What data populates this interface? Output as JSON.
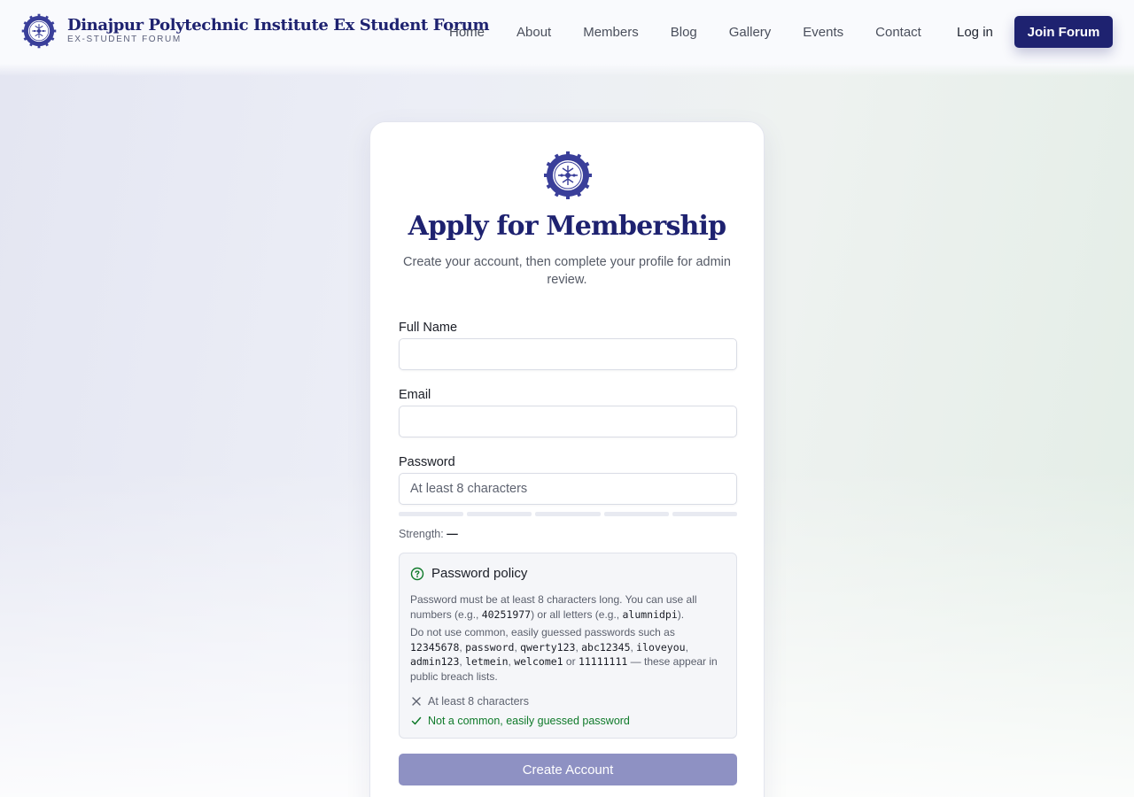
{
  "header": {
    "brand_title": "Dinajpur Polytechnic Institute Ex Student Forum",
    "brand_subtitle": "EX-STUDENT FORUM",
    "logo_icon": "institute-emblem-icon",
    "nav": [
      {
        "label": "Home"
      },
      {
        "label": "About"
      },
      {
        "label": "Members"
      },
      {
        "label": "Blog"
      },
      {
        "label": "Gallery"
      },
      {
        "label": "Events"
      },
      {
        "label": "Contact"
      }
    ],
    "login_label": "Log in",
    "join_label": "Join Forum"
  },
  "form": {
    "title": "Apply for Membership",
    "subtitle": "Create your account, then complete your profile for admin review.",
    "full_name": {
      "label": "Full Name",
      "value": "",
      "placeholder": ""
    },
    "email": {
      "label": "Email",
      "value": "",
      "placeholder": ""
    },
    "password": {
      "label": "Password",
      "value": "",
      "placeholder": "At least 8 characters"
    },
    "strength_label": "Strength:",
    "strength_value": "—",
    "strength_level": 0,
    "policy": {
      "title": "Password policy",
      "para1_a": "Password must be at least 8 characters long. You can use all numbers (e.g., ",
      "para1_code1": "40251977",
      "para1_b": ") or all letters (e.g., ",
      "para1_code2": "alumnidpi",
      "para1_c": ").",
      "para2_a": "Do not use common, easily guessed passwords such as ",
      "common": [
        "12345678",
        "password",
        "qwerty123",
        "abc12345",
        "iloveyou",
        "admin123",
        "letmein",
        "welcome1",
        "11111111"
      ],
      "para2_or": " or ",
      "para2_b": " — these appear in public breach lists.",
      "rules": [
        {
          "text": "At least 8 characters",
          "passed": false
        },
        {
          "text": "Not a common, easily guessed password",
          "passed": true
        }
      ]
    },
    "submit_label": "Create Account"
  },
  "colors": {
    "brand": "#1e2270",
    "submit_disabled": "#8e91c3",
    "pass": "#0f7a2a"
  }
}
